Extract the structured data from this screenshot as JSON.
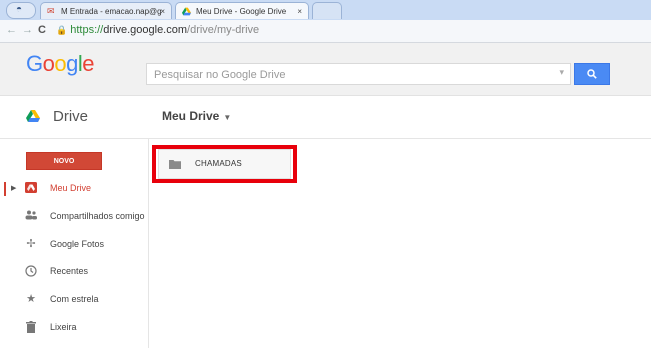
{
  "browser": {
    "tabs": [
      {
        "title": "M Entrada - emacao.nap@g",
        "close": "×",
        "icon": "gmail-icon"
      },
      {
        "title": "Meu Drive - Google Drive",
        "close": "×",
        "icon": "drive-icon"
      }
    ],
    "url_secure": "https://",
    "url_host": "drive.google.com",
    "url_path": "/drive/my-drive"
  },
  "header": {
    "logo": "Google",
    "search_placeholder": "Pesquisar no Google Drive"
  },
  "drivebar": {
    "app_name": "Drive",
    "location": "Meu Drive"
  },
  "sidebar": {
    "new_button": "NOVO",
    "items": [
      {
        "label": "Meu Drive",
        "icon": "my-drive-icon"
      },
      {
        "label": "Compartilhados comigo",
        "icon": "shared-people-icon"
      },
      {
        "label": "Google Fotos",
        "icon": "photos-icon"
      },
      {
        "label": "Recentes",
        "icon": "clock-icon"
      },
      {
        "label": "Com estrela",
        "icon": "star-icon"
      },
      {
        "label": "Lixeira",
        "icon": "trash-icon"
      }
    ]
  },
  "main": {
    "folders": [
      {
        "name": "CHAMADAS",
        "icon": "folder-icon"
      }
    ]
  },
  "colors": {
    "new_button": "#d14836",
    "highlight": "#e8000b",
    "search_button": "#4a8af4"
  }
}
